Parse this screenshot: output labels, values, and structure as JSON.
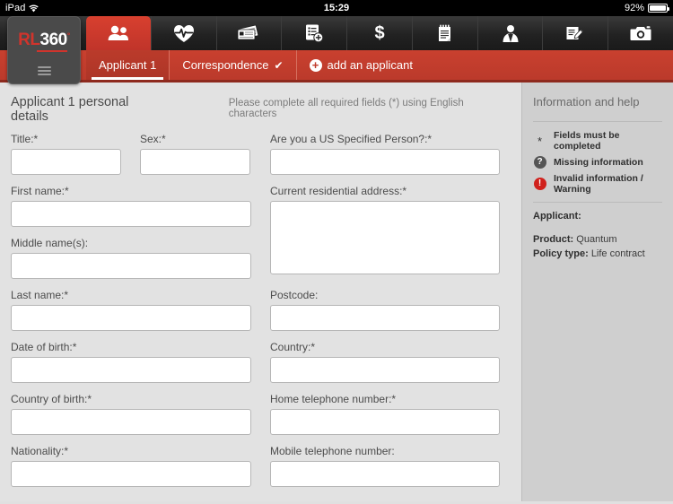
{
  "statusbar": {
    "device": "iPad",
    "wifi_icon": "wifi-icon",
    "time": "15:29",
    "battery_pct": "92%",
    "battery_icon": "battery-icon"
  },
  "logo": {
    "part1": "RL",
    "part2": "360",
    "degree": "°",
    "menu_icon": "hamburger-menu-icon"
  },
  "icon_tabs": [
    {
      "name": "people-icon",
      "label": "Applicants",
      "active": true
    },
    {
      "name": "heart-pulse-icon",
      "label": "Health",
      "active": false
    },
    {
      "name": "id-cards-icon",
      "label": "Identification",
      "active": false
    },
    {
      "name": "document-add-icon",
      "label": "Add document",
      "active": false
    },
    {
      "name": "dollar-icon",
      "label": "Payments",
      "active": false
    },
    {
      "name": "notepad-icon",
      "label": "Notes",
      "active": false
    },
    {
      "name": "person-suit-icon",
      "label": "Adviser",
      "active": false
    },
    {
      "name": "signature-icon",
      "label": "Signature",
      "active": false
    },
    {
      "name": "camera-icon",
      "label": "Camera",
      "active": false
    }
  ],
  "tabs": [
    {
      "label": "Applicant 1",
      "active": true,
      "check": ""
    },
    {
      "label": "Correspondence",
      "active": false,
      "check": "✔"
    }
  ],
  "add_applicant": {
    "plus": "+",
    "label": "add an applicant"
  },
  "form": {
    "title": "Applicant 1 personal details",
    "note": "Please complete all required fields (*) using English characters",
    "left_fields": [
      {
        "label": "Title:*",
        "value": "",
        "type": "text",
        "half": true
      },
      {
        "label": "Sex:*",
        "value": "",
        "type": "text",
        "half": true
      },
      {
        "label": "First name:*",
        "value": "",
        "type": "text"
      },
      {
        "label": "Middle name(s):",
        "value": "",
        "type": "text"
      },
      {
        "label": "Last name:*",
        "value": "",
        "type": "text"
      },
      {
        "label": "Date of birth:*",
        "value": "",
        "type": "text"
      },
      {
        "label": "Country of birth:*",
        "value": "",
        "type": "text"
      },
      {
        "label": "Nationality:*",
        "value": "",
        "type": "text"
      }
    ],
    "right_fields": [
      {
        "label": "Are you a US Specified Person?:*",
        "value": "",
        "type": "text"
      },
      {
        "label": "Current residential address:*",
        "value": "",
        "type": "textarea"
      },
      {
        "label": "Postcode:",
        "value": "",
        "type": "text"
      },
      {
        "label": "Country:*",
        "value": "",
        "type": "text"
      },
      {
        "label": "Home telephone number:*",
        "value": "",
        "type": "text"
      },
      {
        "label": "Mobile telephone number:",
        "value": "",
        "type": "text"
      }
    ]
  },
  "sidebar": {
    "title": "Information and help",
    "legend": [
      {
        "icon": "asterisk-icon",
        "glyph": "*",
        "text": "Fields must be completed",
        "style": "star"
      },
      {
        "icon": "question-mark-icon",
        "glyph": "?",
        "text": "Missing information",
        "style": "question"
      },
      {
        "icon": "warning-exclamation-icon",
        "glyph": "!",
        "text": "Invalid information / Warning",
        "style": "warning"
      }
    ],
    "applicant_label": "Applicant:",
    "applicant_value": "",
    "details": [
      {
        "label": "Product:",
        "value": "Quantum"
      },
      {
        "label": "Policy type:",
        "value": "Life contract"
      }
    ]
  },
  "colors": {
    "brand_red": "#c9402f",
    "brand_red_dark": "#8e2a1e",
    "logo_red": "#d0342c",
    "warning_red": "#d0211c",
    "topbar_dark": "#222222",
    "panel_gray": "#e2e2e2",
    "sidebar_gray": "#cfcfcf"
  }
}
